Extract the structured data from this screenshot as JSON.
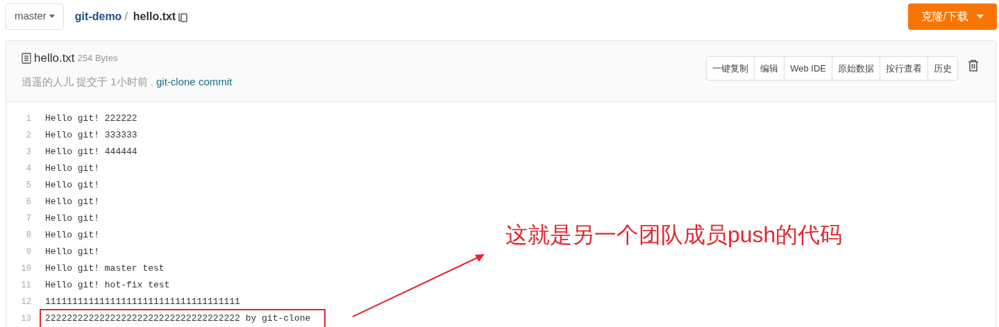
{
  "branch": "master",
  "breadcrumb": {
    "repo": "git-demo",
    "separator": "/",
    "file": "hello.txt"
  },
  "clone_button": "克隆/下载",
  "file": {
    "name": "hello.txt",
    "size": "254 Bytes",
    "commit_info": "逍遥的人儿 提交于 1小时前 .",
    "commit_message": "git-clone commit"
  },
  "actions": [
    "一键复制",
    "编辑",
    "Web IDE",
    "原始数据",
    "按行查看",
    "历史"
  ],
  "lines": [
    {
      "number": "1",
      "text": "Hello git! 222222",
      "highlighted": false
    },
    {
      "number": "2",
      "text": "Hello git! 333333",
      "highlighted": false
    },
    {
      "number": "3",
      "text": "Hello git! 444444",
      "highlighted": false
    },
    {
      "number": "4",
      "text": "Hello git!",
      "highlighted": false
    },
    {
      "number": "5",
      "text": "Hello git!",
      "highlighted": false
    },
    {
      "number": "6",
      "text": "Hello git!",
      "highlighted": false
    },
    {
      "number": "7",
      "text": "Hello git!",
      "highlighted": false
    },
    {
      "number": "8",
      "text": "Hello git!",
      "highlighted": false
    },
    {
      "number": "9",
      "text": "Hello git!",
      "highlighted": false
    },
    {
      "number": "10",
      "text": "Hello git! master test",
      "highlighted": false
    },
    {
      "number": "11",
      "text": "Hello git! hot-fix test",
      "highlighted": false
    },
    {
      "number": "12",
      "text": "111111111111111111111111111111111111",
      "highlighted": false
    },
    {
      "number": "13",
      "text": "222222222222222222222222222222222222 by git-clone",
      "highlighted": true
    }
  ],
  "annotation": {
    "text": "这就是另一个团队成员push的代码"
  }
}
